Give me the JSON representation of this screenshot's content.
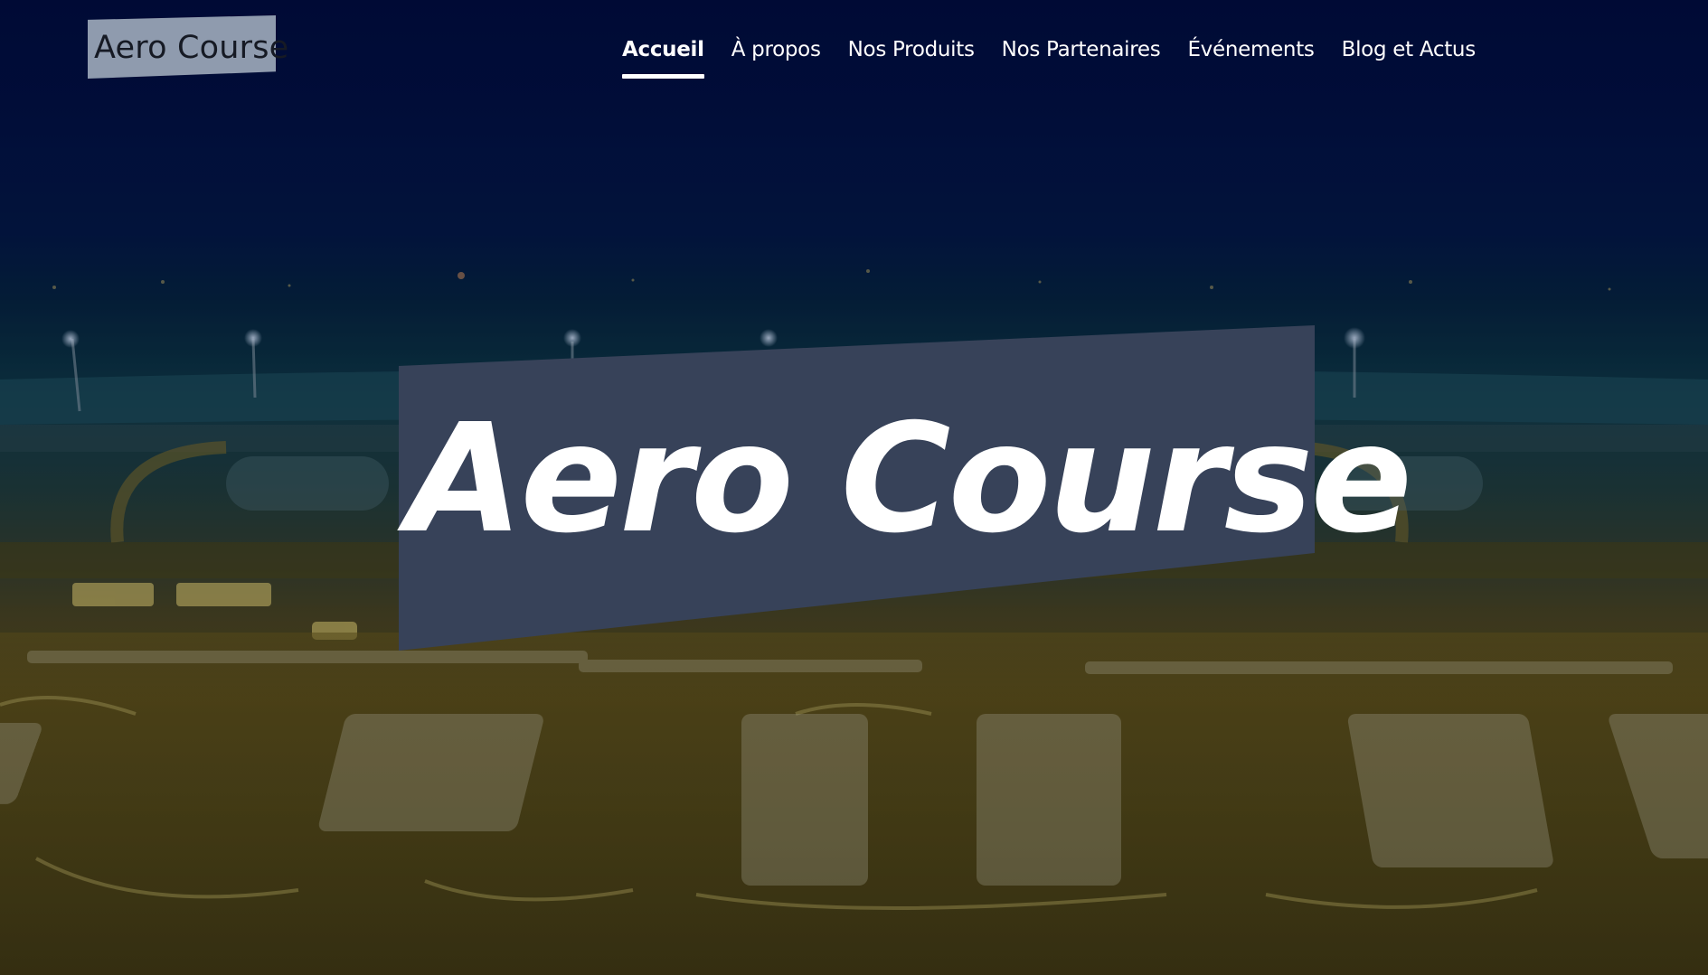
{
  "site": {
    "logo_text": "Aero Course"
  },
  "nav": {
    "items": [
      {
        "label": "Accueil",
        "active": true
      },
      {
        "label": "À propos",
        "active": false
      },
      {
        "label": "Nos Produits",
        "active": false
      },
      {
        "label": "Nos Partenaires",
        "active": false
      },
      {
        "label": "Événements",
        "active": false
      },
      {
        "label": "Blog et Actus",
        "active": false
      }
    ]
  },
  "hero": {
    "title": "Aero Course",
    "banner_color": "#374259",
    "background": "airport-terminal-parking-night-photo"
  }
}
